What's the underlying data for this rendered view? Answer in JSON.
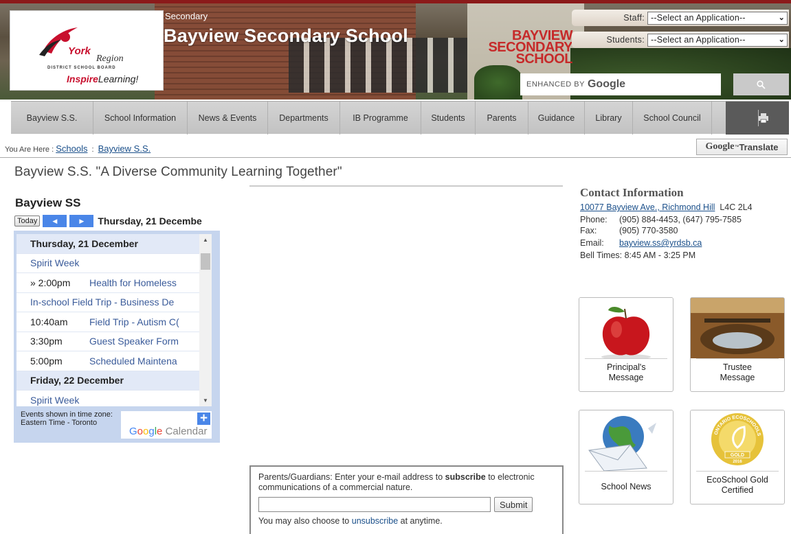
{
  "header": {
    "secondary_label": "Secondary",
    "title": "Bayview Secondary School",
    "sign_lines": [
      "BAYVIEW",
      "SECONDARY",
      "SCHOOL"
    ],
    "logo": {
      "york": "York",
      "region": "Region",
      "board": "DISTRICT SCHOOL BOARD",
      "inspire_bold": "Inspire",
      "inspire_rest": "Learning!"
    },
    "staff_label": "Staff:",
    "staff_select": "--Select an Application--",
    "students_label": "Students:",
    "students_select": "--Select an Application--",
    "search_enhanced": "ENHANCED BY",
    "search_google": "Google"
  },
  "nav": {
    "items": [
      "Bayview S.S.",
      "School Information",
      "News & Events",
      "Departments",
      "IB Programme",
      "Students",
      "Parents",
      "Guidance",
      "Library",
      "School Council"
    ]
  },
  "breadcrumb": {
    "prefix": "You Are Here :",
    "links": [
      "Schools",
      "Bayview S.S."
    ],
    "separator": ":",
    "translate_google": "Google",
    "translate_tm": "™",
    "translate_label": "Translate"
  },
  "tagline": "Bayview S.S. \"A Diverse Community Learning Together\"",
  "calendar": {
    "title": "Bayview SS",
    "today": "Today",
    "prev_glyph": "◀",
    "next_glyph": "▶",
    "current_date": "Thursday, 21 Decembe",
    "rows": [
      {
        "kind": "day",
        "text": "Thursday, 21 December"
      },
      {
        "kind": "allday",
        "text": "Spirit Week"
      },
      {
        "kind": "timed",
        "time": "» 2:00pm",
        "text": "Health for Homeless"
      },
      {
        "kind": "allday",
        "text": "In-school Field Trip - Business De"
      },
      {
        "kind": "timed",
        "time": "10:40am",
        "text": "Field Trip - Autism C("
      },
      {
        "kind": "timed",
        "time": "3:30pm",
        "text": "Guest Speaker Form"
      },
      {
        "kind": "timed",
        "time": "5:00pm",
        "text": "Scheduled Maintena"
      },
      {
        "kind": "day",
        "text": "Friday, 22 December"
      },
      {
        "kind": "allday",
        "text": "Spirit Week"
      }
    ],
    "timezone_note": "Events shown in time zone: Eastern Time - Toronto",
    "plus": "+",
    "gcal_google": "Google",
    "gcal_calendar": "Calendar"
  },
  "subscribe": {
    "text_before": "Parents/Guardians: Enter your e-mail address to ",
    "text_bold": "subscribe",
    "text_after": " to electronic communications of a commercial nature.",
    "submit": "Submit",
    "unsub_before": "You may also choose to ",
    "unsub_link": "unsubscribe",
    "unsub_after": " at anytime."
  },
  "contact": {
    "heading": "Contact Information",
    "address_link": "10077 Bayview Ave., Richmond Hill",
    "postal": "L4C 2L4",
    "phone_label": "Phone:",
    "phone": "(905) 884-4453, (647) 795-7585",
    "fax_label": "Fax:",
    "fax": "(905) 770-3580",
    "email_label": "Email:",
    "email": "bayview.ss@yrdsb.ca",
    "bell": "Bell Times: 8:45 AM - 3:25 PM"
  },
  "tiles": [
    {
      "caption": "Principal's Message"
    },
    {
      "caption": "Trustee Message"
    },
    {
      "caption": "School News"
    },
    {
      "caption": "EcoSchool Gold Certified"
    }
  ],
  "eco_badge": {
    "ring": "ONTARIO ECOSCHOOLS",
    "level": "GOLD",
    "year": "2016"
  },
  "colors": {
    "link": "#1a4f8a",
    "calendar_accent": "#4a86e8",
    "calendar_event": "#3a5b9a",
    "header_topline": "#8b1a1a"
  }
}
